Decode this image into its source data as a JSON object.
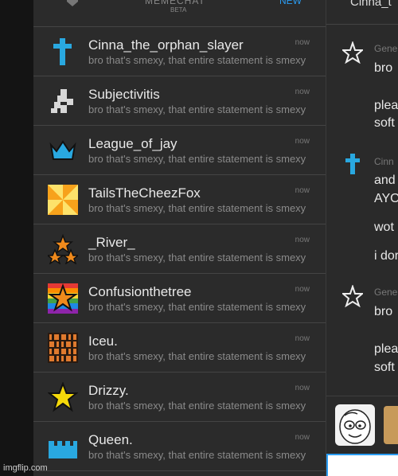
{
  "top": {
    "title": "MEMECHAT",
    "beta": "BETA",
    "new": "NEW"
  },
  "chat_list": [
    {
      "name": "Cinna_the_orphan_slayer",
      "preview": "bro that's smexy, that entire statement is smexy",
      "time": "now",
      "avatar": "blue-cross-icon"
    },
    {
      "name": "Subjectivitis",
      "preview": "bro that's smexy, that entire statement is smexy",
      "time": "now",
      "avatar": "pixel-figure-icon"
    },
    {
      "name": "League_of_jay",
      "preview": "bro that's smexy, that entire statement is smexy",
      "time": "now",
      "avatar": "blue-crown-icon"
    },
    {
      "name": "TailsTheCheezFox",
      "preview": "bro that's smexy, that entire statement is smexy",
      "time": "now",
      "avatar": "orange-burst-icon"
    },
    {
      "name": "_River_",
      "preview": "bro that's smexy, that entire statement is smexy",
      "time": "now",
      "avatar": "three-stars-icon"
    },
    {
      "name": "Confusionthetree",
      "preview": "bro that's smexy, that entire statement is smexy",
      "time": "now",
      "avatar": "rainbow-star-icon"
    },
    {
      "name": "Iceu.",
      "preview": "bro that's smexy, that entire statement is smexy",
      "time": "now",
      "avatar": "binary-tile-icon"
    },
    {
      "name": "Drizzy.",
      "preview": "bro that's smexy, that entire statement is smexy",
      "time": "now",
      "avatar": "yellow-star-icon"
    },
    {
      "name": "Queen.",
      "preview": "bro that's smexy, that entire statement is smexy",
      "time": "now",
      "avatar": "blue-castle-icon"
    }
  ],
  "conversation": {
    "header": "Cinna_t",
    "messages": [
      {
        "sender": "Gene",
        "lines": [
          "bro",
          "",
          "plea",
          "soft"
        ],
        "icon": "outline-star-icon"
      },
      {
        "sender": "Cinn",
        "lines": [
          "and",
          "AYO",
          "wot",
          "i dor"
        ],
        "icon": "blue-cross-icon"
      },
      {
        "sender": "Gene",
        "lines": [
          "bro",
          "",
          "plea",
          "soft"
        ],
        "icon": "outline-star-icon"
      }
    ]
  },
  "watermark": "imgflip.com",
  "colors": {
    "accent": "#2a9df4",
    "panel": "#2b2b2b",
    "divider": "#444444"
  }
}
